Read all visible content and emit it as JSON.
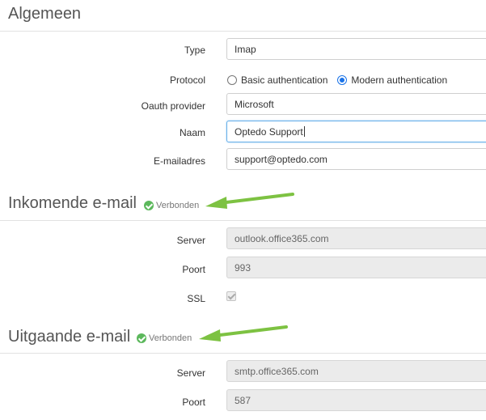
{
  "general": {
    "title": "Algemeen",
    "type_label": "Type",
    "type_value": "Imap",
    "protocol_label": "Protocol",
    "protocol_options": [
      "Basic authentication",
      "Modern authentication"
    ],
    "protocol_selected": "Modern authentication",
    "oauth_label": "Oauth provider",
    "oauth_value": "Microsoft",
    "name_label": "Naam",
    "name_value": "Optedo Support",
    "email_label": "E-mailadres",
    "email_value": "support@optedo.com"
  },
  "incoming": {
    "title": "Inkomende e-mail",
    "status": "Verbonden",
    "server_label": "Server",
    "server_value": "outlook.office365.com",
    "port_label": "Poort",
    "port_value": "993",
    "ssl_label": "SSL",
    "ssl_checked": true
  },
  "outgoing": {
    "title": "Uitgaande e-mail",
    "status": "Verbonden",
    "server_label": "Server",
    "server_value": "smtp.office365.com",
    "port_label": "Poort",
    "port_value": "587"
  },
  "colors": {
    "status_green": "#5cb85c",
    "arrow_green": "#7dc242",
    "radio_blue": "#1a73e8"
  }
}
